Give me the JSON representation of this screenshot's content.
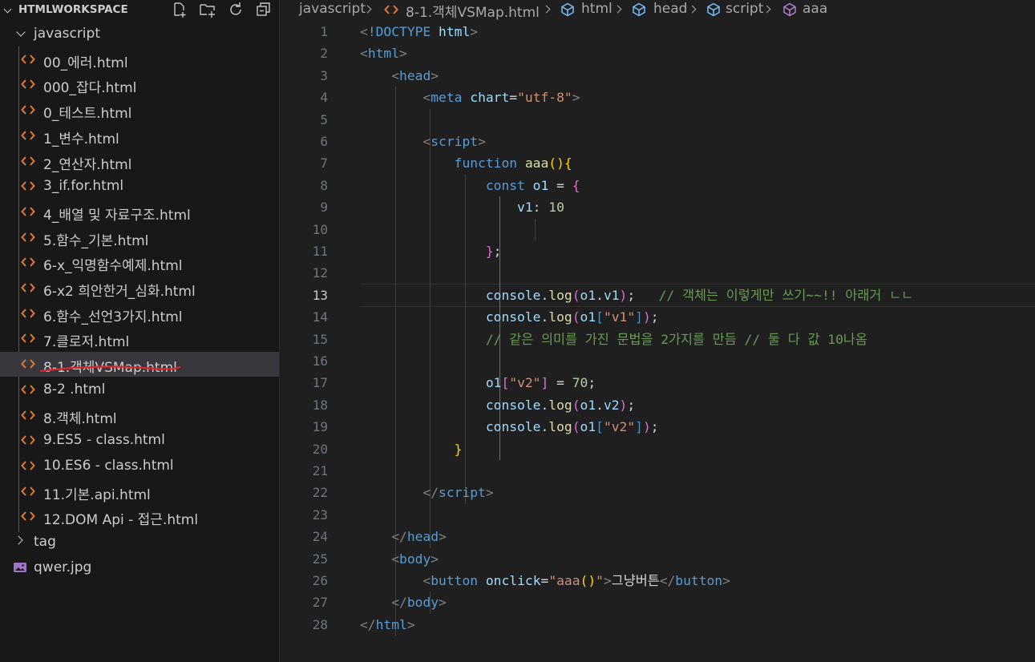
{
  "explorer": {
    "workspace_title": "HTMLWORKSPACE",
    "actions": [
      "new-file",
      "new-folder",
      "refresh",
      "collapse-all"
    ],
    "tree": [
      {
        "type": "folder",
        "label": "javascript",
        "depth": 0,
        "expanded": true
      },
      {
        "type": "file",
        "label": "00_에러.html",
        "depth": 1
      },
      {
        "type": "file",
        "label": "000_잡다.html",
        "depth": 1
      },
      {
        "type": "file",
        "label": "0_테스트.html",
        "depth": 1
      },
      {
        "type": "file",
        "label": "1_변수.html",
        "depth": 1
      },
      {
        "type": "file",
        "label": "2_연산자.html",
        "depth": 1
      },
      {
        "type": "file",
        "label": "3_if.for.html",
        "depth": 1
      },
      {
        "type": "file",
        "label": "4_배열 및 자료구조.html",
        "depth": 1
      },
      {
        "type": "file",
        "label": "5.함수_기본.html",
        "depth": 1
      },
      {
        "type": "file",
        "label": "6-x_익명함수예제.html",
        "depth": 1
      },
      {
        "type": "file",
        "label": "6-x2 희안한거_심화.html",
        "depth": 1
      },
      {
        "type": "file",
        "label": "6.함수_선언3가지.html",
        "depth": 1
      },
      {
        "type": "file",
        "label": "7.클로저.html",
        "depth": 1
      },
      {
        "type": "file",
        "label": "8-1.객체VSMap.html",
        "depth": 1,
        "selected": true
      },
      {
        "type": "file",
        "label": "8-2 .html",
        "depth": 1
      },
      {
        "type": "file",
        "label": "8.객체.html",
        "depth": 1
      },
      {
        "type": "file",
        "label": "9.ES5 - class.html",
        "depth": 1
      },
      {
        "type": "file",
        "label": "10.ES6 - class.html",
        "depth": 1
      },
      {
        "type": "file",
        "label": "11.기본.api.html",
        "depth": 1
      },
      {
        "type": "file",
        "label": "12.DOM Api - 접근.html",
        "depth": 1
      },
      {
        "type": "folder",
        "label": "tag",
        "depth": 0,
        "expanded": false
      },
      {
        "type": "image",
        "label": "qwer.jpg",
        "depth": 0
      }
    ]
  },
  "breadcrumb": [
    {
      "label": "javascript",
      "icon": ""
    },
    {
      "label": "8-1.객체VSMap.html",
      "icon": "html-file-icon"
    },
    {
      "label": "html",
      "icon": "element-icon"
    },
    {
      "label": "head",
      "icon": "element-icon"
    },
    {
      "label": "script",
      "icon": "element-icon"
    },
    {
      "label": "aaa",
      "icon": "method-icon"
    }
  ],
  "editor": {
    "active_line": 13,
    "lines": [
      [
        [
          "punct",
          "<"
        ],
        [
          "tag",
          "!DOCTYPE"
        ],
        [
          "text",
          " "
        ],
        [
          "attr",
          "html"
        ],
        [
          "punct",
          ">"
        ]
      ],
      [
        [
          "punct",
          "<"
        ],
        [
          "tag",
          "html"
        ],
        [
          "punct",
          ">"
        ]
      ],
      [
        [
          "text",
          "    "
        ],
        [
          "punct",
          "<"
        ],
        [
          "tag",
          "head"
        ],
        [
          "punct",
          ">"
        ]
      ],
      [
        [
          "text",
          "        "
        ],
        [
          "punct",
          "<"
        ],
        [
          "tag",
          "meta"
        ],
        [
          "text",
          " "
        ],
        [
          "attr",
          "chart"
        ],
        [
          "text",
          "="
        ],
        [
          "str",
          "\"utf-8\""
        ],
        [
          "punct",
          ">"
        ]
      ],
      [],
      [
        [
          "text",
          "        "
        ],
        [
          "punct",
          "<"
        ],
        [
          "tag",
          "script"
        ],
        [
          "punct",
          ">"
        ]
      ],
      [
        [
          "text",
          "            "
        ],
        [
          "kw",
          "function"
        ],
        [
          "text",
          " "
        ],
        [
          "fn",
          "aaa"
        ],
        [
          "b1",
          "()"
        ],
        [
          "b1",
          "{"
        ]
      ],
      [
        [
          "text",
          "                "
        ],
        [
          "kw",
          "const"
        ],
        [
          "text",
          " "
        ],
        [
          "var",
          "o1"
        ],
        [
          "text",
          " = "
        ],
        [
          "b2",
          "{"
        ]
      ],
      [
        [
          "text",
          "                    "
        ],
        [
          "var",
          "v1"
        ],
        [
          "text",
          ": "
        ],
        [
          "num",
          "10"
        ]
      ],
      [],
      [
        [
          "text",
          "                "
        ],
        [
          "b2",
          "}"
        ],
        [
          "text",
          ";"
        ]
      ],
      [],
      [
        [
          "text",
          "                "
        ],
        [
          "var",
          "console"
        ],
        [
          "text",
          "."
        ],
        [
          "fn",
          "log"
        ],
        [
          "b2",
          "("
        ],
        [
          "var",
          "o1"
        ],
        [
          "text",
          "."
        ],
        [
          "var",
          "v1"
        ],
        [
          "b2",
          ")"
        ],
        [
          "text",
          ";   "
        ],
        [
          "cmt",
          "// 객체는 이렇게만 쓰기~~!! 아래거 ㄴㄴ"
        ]
      ],
      [
        [
          "text",
          "                "
        ],
        [
          "var",
          "console"
        ],
        [
          "text",
          "."
        ],
        [
          "fn",
          "log"
        ],
        [
          "b2",
          "("
        ],
        [
          "var",
          "o1"
        ],
        [
          "b3",
          "["
        ],
        [
          "str",
          "\"v1\""
        ],
        [
          "b3",
          "]"
        ],
        [
          "b2",
          ")"
        ],
        [
          "text",
          ";"
        ]
      ],
      [
        [
          "text",
          "                "
        ],
        [
          "cmt",
          "// 같은 의미를 가진 문법을 2가지를 만듬 // 둘 다 값 10나옴"
        ]
      ],
      [],
      [
        [
          "text",
          "                "
        ],
        [
          "var",
          "o1"
        ],
        [
          "b2",
          "["
        ],
        [
          "str",
          "\"v2\""
        ],
        [
          "b2",
          "]"
        ],
        [
          "text",
          " = "
        ],
        [
          "num",
          "70"
        ],
        [
          "text",
          ";"
        ]
      ],
      [
        [
          "text",
          "                "
        ],
        [
          "var",
          "console"
        ],
        [
          "text",
          "."
        ],
        [
          "fn",
          "log"
        ],
        [
          "b2",
          "("
        ],
        [
          "var",
          "o1"
        ],
        [
          "text",
          "."
        ],
        [
          "var",
          "v2"
        ],
        [
          "b2",
          ")"
        ],
        [
          "text",
          ";"
        ]
      ],
      [
        [
          "text",
          "                "
        ],
        [
          "var",
          "console"
        ],
        [
          "text",
          "."
        ],
        [
          "fn",
          "log"
        ],
        [
          "b2",
          "("
        ],
        [
          "var",
          "o1"
        ],
        [
          "b3",
          "["
        ],
        [
          "str",
          "\"v2\""
        ],
        [
          "b3",
          "]"
        ],
        [
          "b2",
          ")"
        ],
        [
          "text",
          ";"
        ]
      ],
      [
        [
          "text",
          "            "
        ],
        [
          "b1",
          "}"
        ]
      ],
      [],
      [
        [
          "text",
          "        "
        ],
        [
          "punct",
          "</"
        ],
        [
          "tag",
          "script"
        ],
        [
          "punct",
          ">"
        ]
      ],
      [],
      [
        [
          "text",
          "    "
        ],
        [
          "punct",
          "</"
        ],
        [
          "tag",
          "head"
        ],
        [
          "punct",
          ">"
        ]
      ],
      [
        [
          "text",
          "    "
        ],
        [
          "punct",
          "<"
        ],
        [
          "tag",
          "body"
        ],
        [
          "punct",
          ">"
        ]
      ],
      [
        [
          "text",
          "        "
        ],
        [
          "punct",
          "<"
        ],
        [
          "tag",
          "button"
        ],
        [
          "text",
          " "
        ],
        [
          "attr",
          "onclick"
        ],
        [
          "text",
          "="
        ],
        [
          "str",
          "\"aaa"
        ],
        [
          "b1",
          "()"
        ],
        [
          "str",
          "\""
        ],
        [
          "punct",
          ">"
        ],
        [
          "text",
          "그냥버튼"
        ],
        [
          "punct",
          "</"
        ],
        [
          "tag",
          "button"
        ],
        [
          "punct",
          ">"
        ]
      ],
      [
        [
          "text",
          "    "
        ],
        [
          "punct",
          "</"
        ],
        [
          "tag",
          "body"
        ],
        [
          "punct",
          ">"
        ]
      ],
      [
        [
          "punct",
          "</"
        ],
        [
          "tag",
          "html"
        ],
        [
          "punct",
          ">"
        ]
      ]
    ]
  }
}
